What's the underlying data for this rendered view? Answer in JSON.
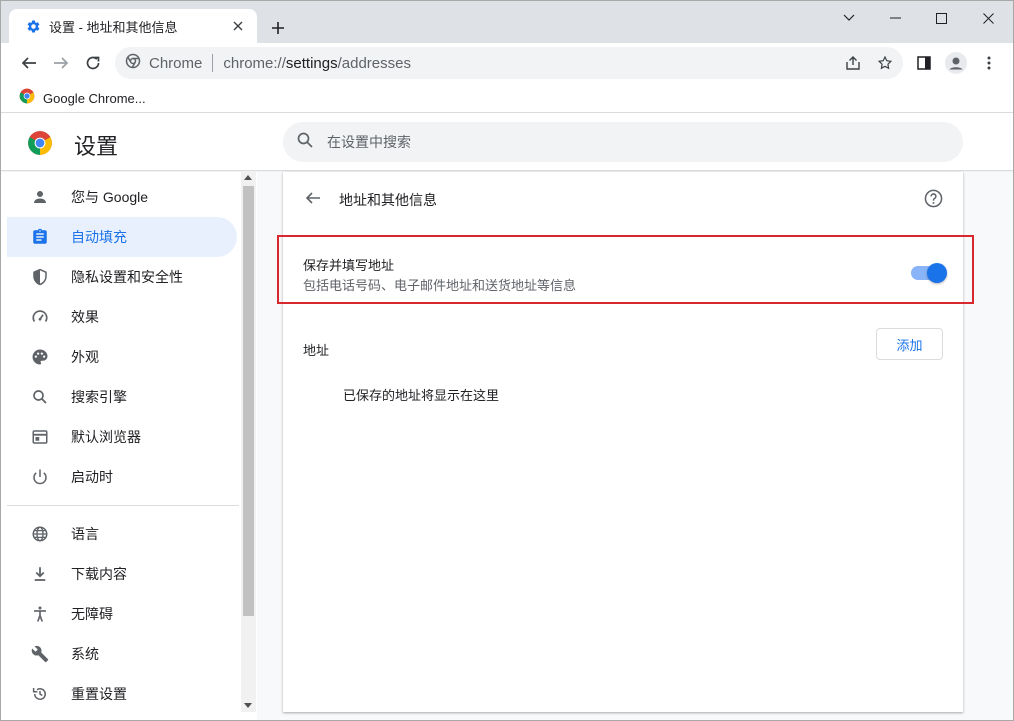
{
  "tab": {
    "title": "设置 - 地址和其他信息",
    "new_tab": "+"
  },
  "window_controls": {
    "dropdown": "⌄",
    "minimize": "—",
    "maximize": "☐",
    "close": "✕"
  },
  "omnibox": {
    "site_label": "Chrome",
    "url_scheme": "chrome://",
    "url_host": "settings",
    "url_path": "/addresses"
  },
  "bookmarks": [
    {
      "label": "Google Chrome..."
    }
  ],
  "header": {
    "title": "设置",
    "search_placeholder": "在设置中搜索"
  },
  "sidebar": {
    "items": [
      {
        "label": "您与 Google",
        "icon": "person-icon"
      },
      {
        "label": "自动填充",
        "icon": "clipboard-icon",
        "active": true
      },
      {
        "label": "隐私设置和安全性",
        "icon": "shield-icon"
      },
      {
        "label": "效果",
        "icon": "speedometer-icon"
      },
      {
        "label": "外观",
        "icon": "palette-icon"
      },
      {
        "label": "搜索引擎",
        "icon": "search-icon"
      },
      {
        "label": "默认浏览器",
        "icon": "browser-icon"
      },
      {
        "label": "启动时",
        "icon": "power-icon"
      },
      {
        "label": "语言",
        "icon": "globe-icon"
      },
      {
        "label": "下载内容",
        "icon": "download-icon"
      },
      {
        "label": "无障碍",
        "icon": "accessibility-icon"
      },
      {
        "label": "系统",
        "icon": "wrench-icon"
      },
      {
        "label": "重置设置",
        "icon": "reset-icon"
      }
    ]
  },
  "main": {
    "page_title": "地址和其他信息",
    "toggle": {
      "title": "保存并填写地址",
      "subtitle": "包括电话号码、电子邮件地址和送货地址等信息",
      "enabled": true
    },
    "section_label": "地址",
    "add_button": "添加",
    "empty_message": "已保存的地址将显示在这里"
  },
  "colors": {
    "accent": "#1a73e8",
    "highlight": "#d9272e",
    "active_bg": "#e8f0fe"
  }
}
